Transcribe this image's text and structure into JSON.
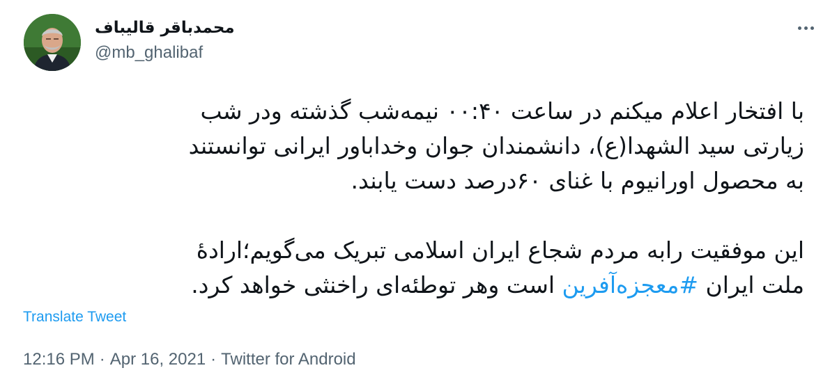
{
  "author": {
    "display_name": "محمدباقر قالیباف",
    "handle": "@mb_ghalibaf",
    "avatar_icon": "profile-photo"
  },
  "more_icon": "more-horizontal-icon",
  "tweet": {
    "lines_paragraph_1": [
      "با افتخار اعلام میکنم در ساعت ۰۰:۴۰ نیمه‌شب گذشته ودر شب",
      "زیارتی سید الشهدا(ع)، دانشمندان جوان وخداباور ایرانی توانستند",
      "به محصول اورانیوم با غنای ۶۰درصد دست یابند."
    ],
    "paragraph_2_line_1": "این موفقیت رابه مردم شجاع ایران اسلامی تبریک می‌گویم؛ارادۀ",
    "paragraph_2_line_2_before": "ملت ایران ",
    "hashtag": "#معجزه‌آفرین",
    "paragraph_2_line_2_after": " است وهر توطئه‌ای راخنثی خواهد کرد."
  },
  "translate_label": "Translate Tweet",
  "meta": {
    "time": "12:16 PM",
    "separator": "·",
    "date": "Apr 16, 2021",
    "source": "Twitter for Android"
  },
  "colors": {
    "link": "#1d9bf0",
    "secondary_text": "#536471",
    "primary_text": "#0f1419"
  }
}
